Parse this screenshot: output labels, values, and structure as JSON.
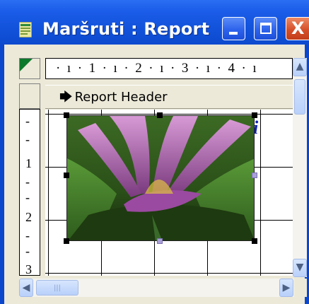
{
  "window": {
    "title": "Maršruti : Report",
    "icon": "report-icon",
    "controls": [
      "minimize-icon",
      "maximize-icon",
      "close-icon"
    ],
    "close_glyph": "X"
  },
  "ruler": {
    "horizontal_text": "· ı · 1 · ı · 2 · ı · 3 · ı · 4 · ı",
    "vertical_marks": [
      "-",
      "-",
      "1",
      "-",
      "-",
      "2",
      "-",
      "-",
      "3"
    ]
  },
  "section": {
    "name": "Report Header",
    "arrow": "🡆"
  },
  "canvas": {
    "label_fragment": "i"
  },
  "image": {
    "subject": "pink water lily photo"
  },
  "scrollbars": {
    "up": "▲",
    "down": "▼",
    "left": "◀",
    "right": "▶",
    "grip": "|||"
  },
  "colors": {
    "titlebar": "#0b45c5",
    "frame": "#0b47cc",
    "close_button": "#d6502a",
    "label_text": "#0b1fb8"
  }
}
